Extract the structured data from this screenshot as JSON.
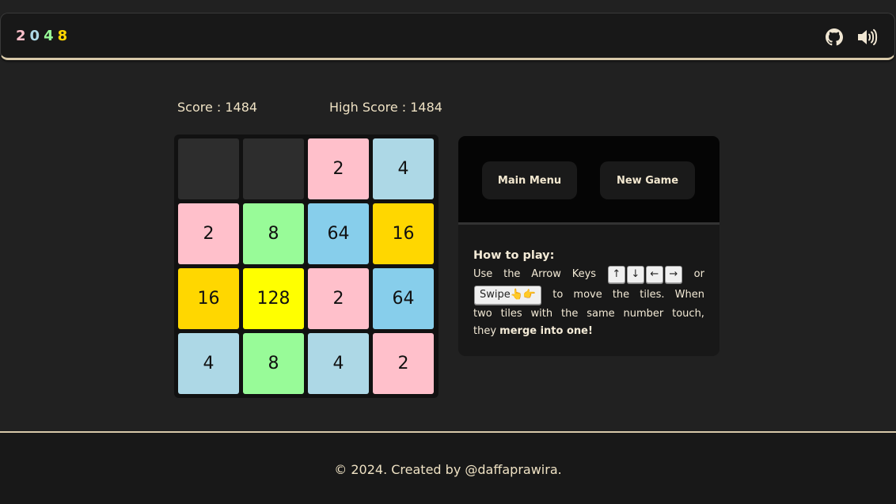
{
  "header": {
    "logo_chars": [
      {
        "char": "2",
        "color": "#ffc0cb"
      },
      {
        "char": "0",
        "color": "#add8e6"
      },
      {
        "char": "4",
        "color": "#98fb98"
      },
      {
        "char": "8",
        "color": "#ffd700"
      }
    ],
    "icons": [
      "github-icon",
      "speaker-icon"
    ]
  },
  "scores": {
    "score_text": "Score : 1484",
    "high_score_text": "High Score : 1484"
  },
  "board": {
    "rows": [
      [
        "",
        "",
        "2",
        "4"
      ],
      [
        "2",
        "8",
        "64",
        "16"
      ],
      [
        "16",
        "128",
        "2",
        "64"
      ],
      [
        "4",
        "8",
        "4",
        "2"
      ]
    ],
    "tile_colors": {
      "": "#2d2d2d",
      "2": "#ffc0cb",
      "4": "#add8e6",
      "8": "#98fb98",
      "16": "#ffd700",
      "64": "#87ceeb",
      "128": "#ffff00"
    }
  },
  "panel": {
    "main_menu_label": "Main Menu",
    "new_game_label": "New Game",
    "howto_title": "How to play:",
    "line1_a": "Use",
    "line1_b": "the",
    "line1_c": "Arrow",
    "line1_d": "Keys",
    "keys": [
      "↑",
      "↓",
      "←",
      "→"
    ],
    "line1_or": "or",
    "swipe_label": "Swipe👆👉",
    "line2_words": [
      "to",
      "move",
      "the",
      "tiles.",
      "When"
    ],
    "line3_words": [
      "two",
      "tiles",
      "with",
      "the",
      "same",
      "number",
      "touch,"
    ],
    "line4_prefix": "they",
    "line4_bold": "merge into one!"
  },
  "footer": {
    "text": "© 2024. Created by @daffaprawira."
  }
}
